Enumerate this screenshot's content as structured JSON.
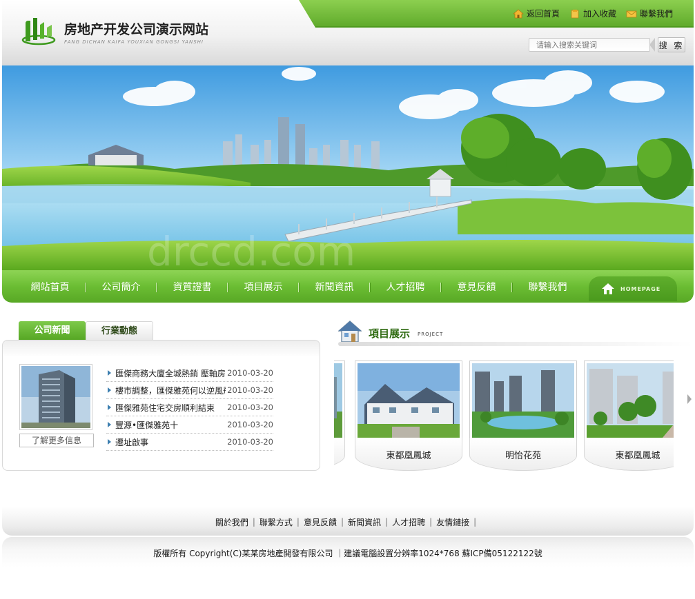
{
  "site": {
    "title": "房地产开发公司演示网站",
    "subtitle": "FANG DICHAN KAIFA YOUXIAN GONGSI YANSHI"
  },
  "toplinks": [
    {
      "label": "返回首頁",
      "icon": "home-icon"
    },
    {
      "label": "加入收藏",
      "icon": "bookmark-icon"
    },
    {
      "label": "聯繫我們",
      "icon": "mail-icon"
    }
  ],
  "search": {
    "placeholder": "请输入搜索关键词",
    "button": "搜 索"
  },
  "banner": {
    "watermark": "drccd.com"
  },
  "nav": {
    "items": [
      "網站首頁",
      "公司簡介",
      "資質證書",
      "項目展示",
      "新聞資訊",
      "人才招聘",
      "意見反饋",
      "聯繫我們"
    ],
    "homepage_label": "HOMEPAGE"
  },
  "news": {
    "tabs": [
      "公司新聞",
      "行業動態"
    ],
    "more": "了解更多信息",
    "items": [
      {
        "title": "匯傑商務大廈全城熱銷 壓軸房",
        "date": "2010-03-20"
      },
      {
        "title": "樓市調整，匯傑雅苑何以逆風飛",
        "date": "2010-03-20"
      },
      {
        "title": "匯傑雅苑住宅交房順利結束",
        "date": "2010-03-20"
      },
      {
        "title": "豐源•匯傑雅苑十",
        "date": "2010-03-20"
      },
      {
        "title": "遷址啟事",
        "date": "2010-03-20"
      }
    ]
  },
  "projects": {
    "title": "項目展示",
    "subtitle": "PROJECT",
    "cards": [
      "東都凰鳳城",
      "明怡花苑",
      "東都凰鳳城"
    ]
  },
  "footer": {
    "links": [
      "關於我們",
      "聯繫方式",
      "意見反饋",
      "新聞資訊",
      "人才招聘",
      "友情鏈接"
    ],
    "copyright": "版權所有 Copyright(C)某某房地產開發有限公司 ｜建議電腦設置分辨率1024*768 蘇ICP備05122122號"
  },
  "colors": {
    "brand_green": "#5ea92a",
    "nav_green": "#6bbd33",
    "title_green": "#2e6a10"
  }
}
